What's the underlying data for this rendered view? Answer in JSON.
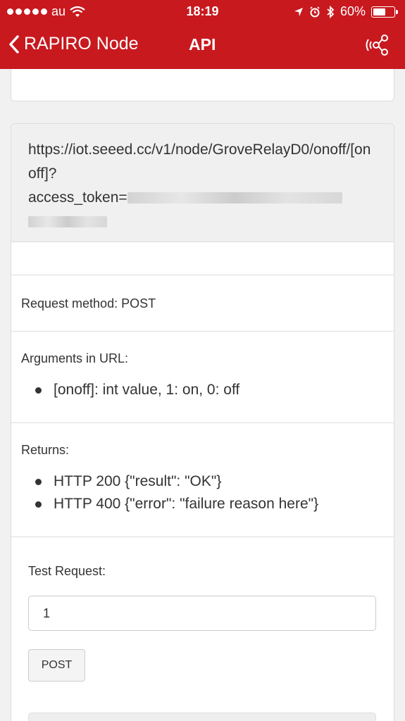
{
  "status_bar": {
    "carrier": "au",
    "time": "18:19",
    "battery": "60%",
    "battery_level": 0.6
  },
  "nav": {
    "back_label": "RAPIRO Node",
    "title": "API"
  },
  "api": {
    "url": "https://iot.seeed.cc/v1/node/GroveRelayD0/onoff/[onoff]?",
    "access_token_label": "access_token=",
    "request_method": "Request method: POST",
    "arguments_heading": "Arguments in URL:",
    "arguments": [
      "[onoff]: int value, 1: on, 0: off"
    ],
    "returns_heading": "Returns:",
    "returns": [
      "HTTP 200 {\"result\": \"OK\"}",
      "HTTP 400 {\"error\": \"failure reason here\"}"
    ]
  },
  "test": {
    "label": "Test Request:",
    "input_value": "1",
    "button_label": "POST"
  },
  "colors": {
    "header": "#c8191f"
  },
  "icons": [
    "signal-dots-icon",
    "wifi-icon",
    "location-arrow-icon",
    "alarm-icon",
    "bluetooth-icon",
    "battery-icon",
    "chevron-left-icon",
    "share-icon"
  ]
}
